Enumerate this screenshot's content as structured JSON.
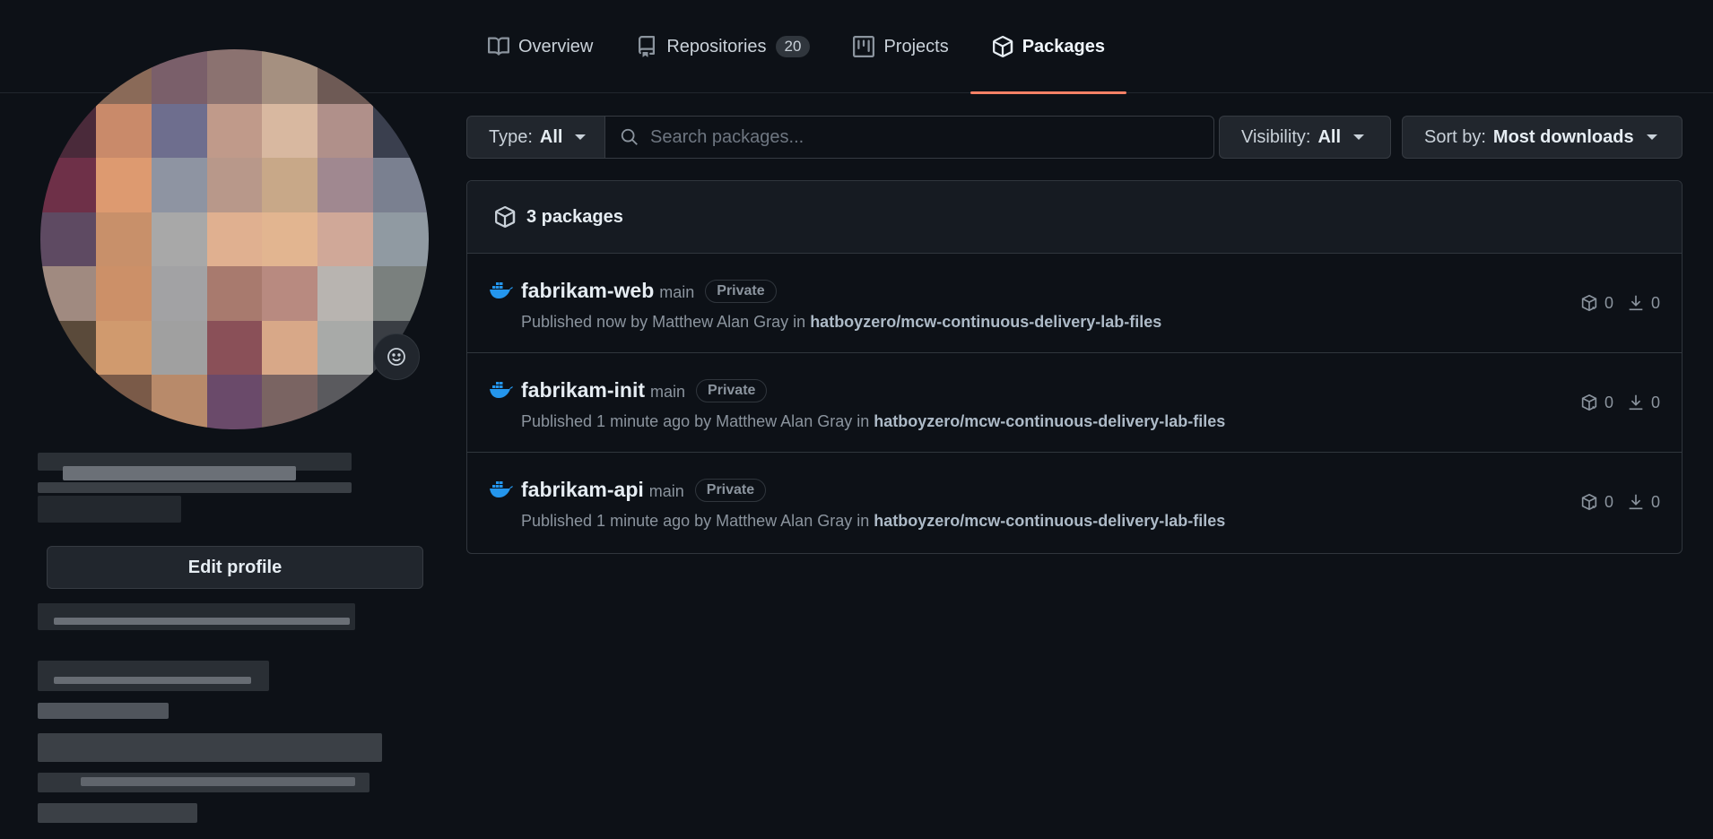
{
  "tabs": [
    {
      "label": "Overview",
      "icon": "book-icon"
    },
    {
      "label": "Repositories",
      "icon": "repo-icon",
      "count": "20"
    },
    {
      "label": "Projects",
      "icon": "project-icon"
    },
    {
      "label": "Packages",
      "icon": "package-icon",
      "active": true
    }
  ],
  "sidebar": {
    "edit_profile_label": "Edit profile"
  },
  "filters": {
    "type_label": "Type:",
    "type_value": "All",
    "search_placeholder": "Search packages...",
    "visibility_label": "Visibility:",
    "visibility_value": "All",
    "sort_label": "Sort by:",
    "sort_value": "Most downloads"
  },
  "packages_header": "3 packages",
  "packages": [
    {
      "name": "fabrikam-web",
      "branch": "main",
      "visibility": "Private",
      "published": "Published now by Matthew Alan Gray in",
      "repo": "hatboyzero/mcw-continuous-delivery-lab-files",
      "versions": "0",
      "downloads": "0"
    },
    {
      "name": "fabrikam-init",
      "branch": "main",
      "visibility": "Private",
      "published": "Published 1 minute ago by Matthew Alan Gray in",
      "repo": "hatboyzero/mcw-continuous-delivery-lab-files",
      "versions": "0",
      "downloads": "0"
    },
    {
      "name": "fabrikam-api",
      "branch": "main",
      "visibility": "Private",
      "published": "Published 1 minute ago by Matthew Alan Gray in",
      "repo": "hatboyzero/mcw-continuous-delivery-lab-files",
      "versions": "0",
      "downloads": "0"
    }
  ],
  "colors": {
    "accent_underline": "#f78166",
    "docker_blue": "#2496ed",
    "background": "#0d1117"
  }
}
